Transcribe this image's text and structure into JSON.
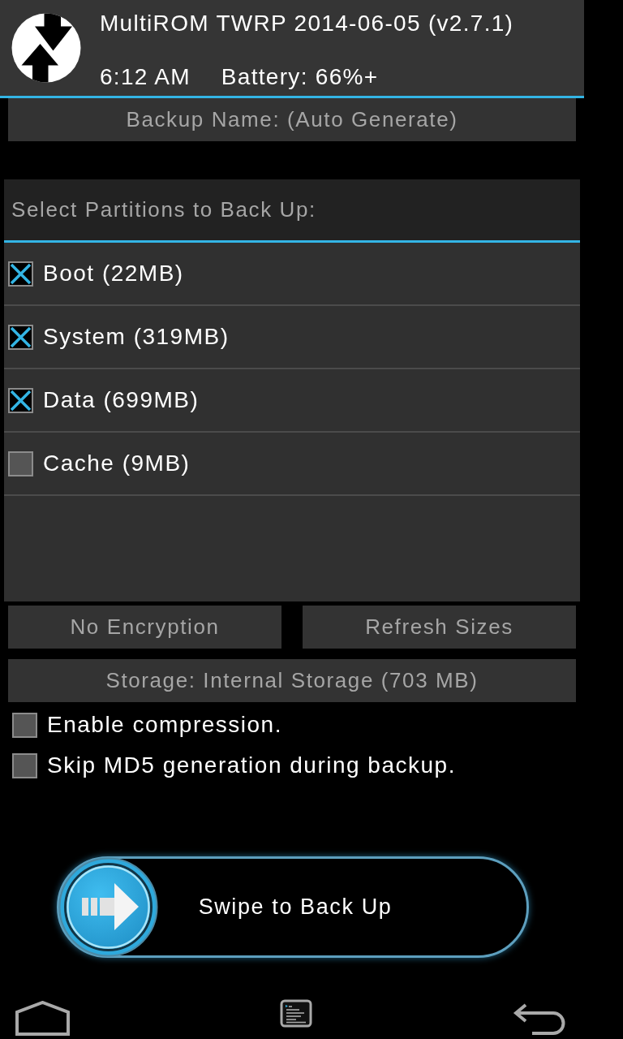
{
  "header": {
    "title": "MultiROM TWRP 2014-06-05 (v2.7.1)",
    "time": "6:12 AM",
    "battery": "Battery: 66%+"
  },
  "backup_name_button": "Backup Name: (Auto Generate)",
  "partitions": {
    "heading": "Select Partitions to Back Up:",
    "items": [
      {
        "label": "Boot (22MB)",
        "checked": true
      },
      {
        "label": "System (319MB)",
        "checked": true
      },
      {
        "label": "Data (699MB)",
        "checked": true
      },
      {
        "label": "Cache (9MB)",
        "checked": false
      }
    ]
  },
  "buttons": [
    "No Encryption",
    "Refresh Sizes"
  ],
  "storage_button": "Storage: Internal Storage (703 MB)",
  "options": [
    {
      "label": "Enable compression.",
      "checked": false
    },
    {
      "label": "Skip MD5 generation during backup.",
      "checked": false
    }
  ],
  "swipe": {
    "label": "Swipe to Back Up",
    "level": 0
  }
}
